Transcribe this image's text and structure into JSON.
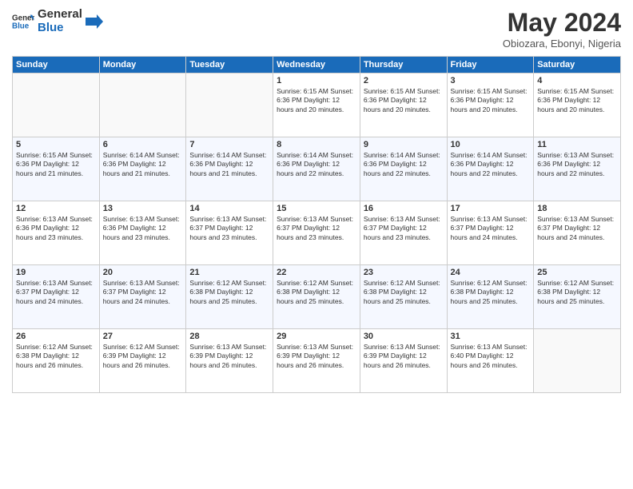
{
  "header": {
    "logo_line1": "General",
    "logo_line2": "Blue",
    "month_year": "May 2024",
    "location": "Obiozara, Ebonyi, Nigeria"
  },
  "days_of_week": [
    "Sunday",
    "Monday",
    "Tuesday",
    "Wednesday",
    "Thursday",
    "Friday",
    "Saturday"
  ],
  "weeks": [
    [
      {
        "day": "",
        "info": ""
      },
      {
        "day": "",
        "info": ""
      },
      {
        "day": "",
        "info": ""
      },
      {
        "day": "1",
        "info": "Sunrise: 6:15 AM\nSunset: 6:36 PM\nDaylight: 12 hours\nand 20 minutes."
      },
      {
        "day": "2",
        "info": "Sunrise: 6:15 AM\nSunset: 6:36 PM\nDaylight: 12 hours\nand 20 minutes."
      },
      {
        "day": "3",
        "info": "Sunrise: 6:15 AM\nSunset: 6:36 PM\nDaylight: 12 hours\nand 20 minutes."
      },
      {
        "day": "4",
        "info": "Sunrise: 6:15 AM\nSunset: 6:36 PM\nDaylight: 12 hours\nand 20 minutes."
      }
    ],
    [
      {
        "day": "5",
        "info": "Sunrise: 6:15 AM\nSunset: 6:36 PM\nDaylight: 12 hours\nand 21 minutes."
      },
      {
        "day": "6",
        "info": "Sunrise: 6:14 AM\nSunset: 6:36 PM\nDaylight: 12 hours\nand 21 minutes."
      },
      {
        "day": "7",
        "info": "Sunrise: 6:14 AM\nSunset: 6:36 PM\nDaylight: 12 hours\nand 21 minutes."
      },
      {
        "day": "8",
        "info": "Sunrise: 6:14 AM\nSunset: 6:36 PM\nDaylight: 12 hours\nand 22 minutes."
      },
      {
        "day": "9",
        "info": "Sunrise: 6:14 AM\nSunset: 6:36 PM\nDaylight: 12 hours\nand 22 minutes."
      },
      {
        "day": "10",
        "info": "Sunrise: 6:14 AM\nSunset: 6:36 PM\nDaylight: 12 hours\nand 22 minutes."
      },
      {
        "day": "11",
        "info": "Sunrise: 6:13 AM\nSunset: 6:36 PM\nDaylight: 12 hours\nand 22 minutes."
      }
    ],
    [
      {
        "day": "12",
        "info": "Sunrise: 6:13 AM\nSunset: 6:36 PM\nDaylight: 12 hours\nand 23 minutes."
      },
      {
        "day": "13",
        "info": "Sunrise: 6:13 AM\nSunset: 6:36 PM\nDaylight: 12 hours\nand 23 minutes."
      },
      {
        "day": "14",
        "info": "Sunrise: 6:13 AM\nSunset: 6:37 PM\nDaylight: 12 hours\nand 23 minutes."
      },
      {
        "day": "15",
        "info": "Sunrise: 6:13 AM\nSunset: 6:37 PM\nDaylight: 12 hours\nand 23 minutes."
      },
      {
        "day": "16",
        "info": "Sunrise: 6:13 AM\nSunset: 6:37 PM\nDaylight: 12 hours\nand 23 minutes."
      },
      {
        "day": "17",
        "info": "Sunrise: 6:13 AM\nSunset: 6:37 PM\nDaylight: 12 hours\nand 24 minutes."
      },
      {
        "day": "18",
        "info": "Sunrise: 6:13 AM\nSunset: 6:37 PM\nDaylight: 12 hours\nand 24 minutes."
      }
    ],
    [
      {
        "day": "19",
        "info": "Sunrise: 6:13 AM\nSunset: 6:37 PM\nDaylight: 12 hours\nand 24 minutes."
      },
      {
        "day": "20",
        "info": "Sunrise: 6:13 AM\nSunset: 6:37 PM\nDaylight: 12 hours\nand 24 minutes."
      },
      {
        "day": "21",
        "info": "Sunrise: 6:12 AM\nSunset: 6:38 PM\nDaylight: 12 hours\nand 25 minutes."
      },
      {
        "day": "22",
        "info": "Sunrise: 6:12 AM\nSunset: 6:38 PM\nDaylight: 12 hours\nand 25 minutes."
      },
      {
        "day": "23",
        "info": "Sunrise: 6:12 AM\nSunset: 6:38 PM\nDaylight: 12 hours\nand 25 minutes."
      },
      {
        "day": "24",
        "info": "Sunrise: 6:12 AM\nSunset: 6:38 PM\nDaylight: 12 hours\nand 25 minutes."
      },
      {
        "day": "25",
        "info": "Sunrise: 6:12 AM\nSunset: 6:38 PM\nDaylight: 12 hours\nand 25 minutes."
      }
    ],
    [
      {
        "day": "26",
        "info": "Sunrise: 6:12 AM\nSunset: 6:38 PM\nDaylight: 12 hours\nand 26 minutes."
      },
      {
        "day": "27",
        "info": "Sunrise: 6:12 AM\nSunset: 6:39 PM\nDaylight: 12 hours\nand 26 minutes."
      },
      {
        "day": "28",
        "info": "Sunrise: 6:13 AM\nSunset: 6:39 PM\nDaylight: 12 hours\nand 26 minutes."
      },
      {
        "day": "29",
        "info": "Sunrise: 6:13 AM\nSunset: 6:39 PM\nDaylight: 12 hours\nand 26 minutes."
      },
      {
        "day": "30",
        "info": "Sunrise: 6:13 AM\nSunset: 6:39 PM\nDaylight: 12 hours\nand 26 minutes."
      },
      {
        "day": "31",
        "info": "Sunrise: 6:13 AM\nSunset: 6:40 PM\nDaylight: 12 hours\nand 26 minutes."
      },
      {
        "day": "",
        "info": ""
      }
    ]
  ]
}
